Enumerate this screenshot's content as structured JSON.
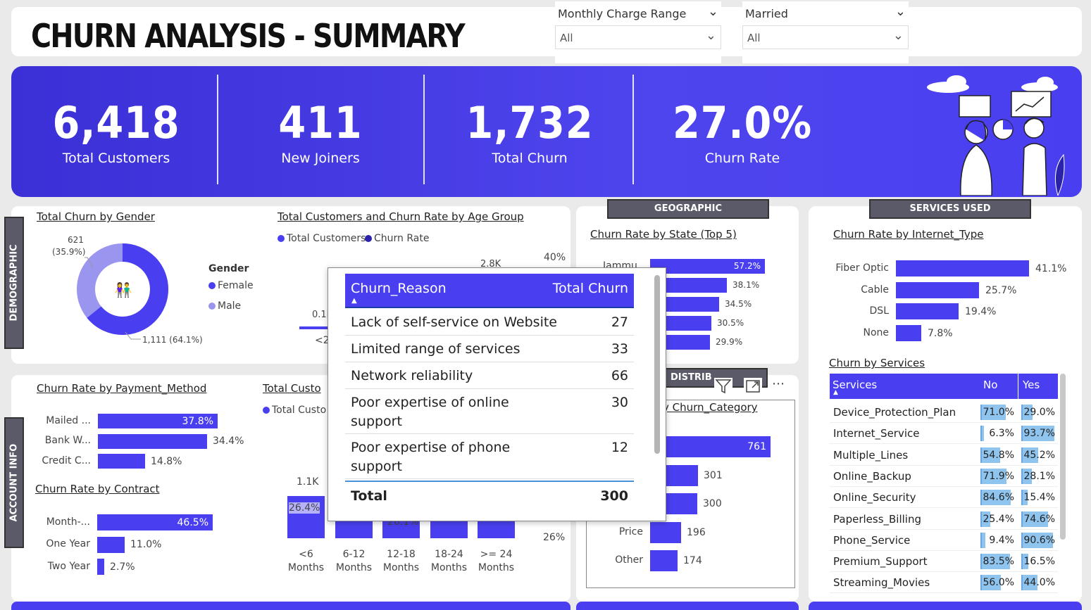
{
  "title": "CHURN ANALYSIS - SUMMARY",
  "filters": [
    {
      "label": "Monthly Charge Range",
      "value": "All"
    },
    {
      "label": "Married",
      "value": "All"
    }
  ],
  "kpis": [
    {
      "value": "6,418",
      "label": "Total Customers"
    },
    {
      "value": "411",
      "label": "New Joiners"
    },
    {
      "value": "1,732",
      "label": "Total Churn"
    },
    {
      "value": "27.0%",
      "label": "Churn Rate"
    }
  ],
  "section_tags": {
    "demographic": "DEMOGRAPHIC",
    "account_info": "ACCOUNT INFO",
    "geographic": "GEOGRAPHIC",
    "services_used": "SERVICES USED",
    "distribution": "DISTRIB"
  },
  "gender": {
    "title": "Total Churn by Gender",
    "legend_title": "Gender",
    "legend": [
      "Female",
      "Male"
    ],
    "male_label": "621",
    "male_pct": "(35.9%)",
    "female_label": "1,111 (64.1%)",
    "female_share": 0.641,
    "colors": {
      "female": "#4a3ff0",
      "male": "#9a95ee"
    }
  },
  "age_group": {
    "title": "Total Customers and Churn Rate by Age Group",
    "legend": [
      "Total Customers",
      "Churn Rate"
    ],
    "visible_labels": {
      "y2_top": "40%",
      "total_top": "2.8K",
      "low": "0.1K",
      "cat_partial": "<20"
    }
  },
  "payment": {
    "title": "Churn Rate by Payment_Method",
    "items": [
      {
        "label": "Mailed ...",
        "value": 37.8,
        "text": "37.8%",
        "inside": true
      },
      {
        "label": "Bank W...",
        "value": 34.4,
        "text": "34.4%",
        "inside": false
      },
      {
        "label": "Credit C...",
        "value": 14.8,
        "text": "14.8%",
        "inside": false
      }
    ]
  },
  "contract": {
    "title": "Churn Rate by Contract",
    "items": [
      {
        "label": "Month-...",
        "value": 46.5,
        "text": "46.5%",
        "inside": true
      },
      {
        "label": "One Year",
        "value": 11.0,
        "text": "11.0%",
        "inside": false
      },
      {
        "label": "Two Year",
        "value": 2.7,
        "text": "2.7%",
        "inside": false
      }
    ]
  },
  "tenure": {
    "title": "Total Customers and Churn Rate by Tenure Group",
    "title_visible": "Total Custo",
    "legend_visible": "Total Custo",
    "categories": [
      "<6 Months",
      "6-12 Months",
      "12-18 Months",
      "18-24 Months",
      ">= 24 Months"
    ],
    "cat_line1": [
      "<6",
      "6-12",
      "12-18",
      "18-24",
      ">= 24"
    ],
    "cat_line2": [
      "Months",
      "Months",
      "Months",
      "Months",
      "Months"
    ],
    "labels": {
      "top": "1.1K",
      "rate1": "26.4%",
      "rate3": "26.1%",
      "right": "26%"
    }
  },
  "state": {
    "title": "Churn Rate by State (Top 5)",
    "first_label": "Jammu",
    "items": [
      {
        "value": 57.2,
        "text": "57.2%",
        "inside": true
      },
      {
        "value": 38.1,
        "text": "38.1%",
        "inside": false
      },
      {
        "value": 34.5,
        "text": "34.5%",
        "inside": false
      },
      {
        "value": 30.5,
        "text": "30.5%",
        "inside": false
      },
      {
        "value": 29.9,
        "text": "29.9%",
        "inside": false
      }
    ]
  },
  "churn_category": {
    "title_visible": "y Churn_Category",
    "items": [
      {
        "label": "",
        "value": 761,
        "text": "761",
        "inside": true
      },
      {
        "label": "",
        "value": 301,
        "text": "301",
        "inside": false
      },
      {
        "label": "",
        "value": 300,
        "text": "300",
        "inside": false
      },
      {
        "label": "Price",
        "value": 196,
        "text": "196",
        "inside": false
      },
      {
        "label": "Other",
        "value": 174,
        "text": "174",
        "inside": false
      }
    ]
  },
  "internet": {
    "title": "Churn Rate by Internet_Type",
    "items": [
      {
        "label": "Fiber Optic",
        "value": 41.1,
        "text": "41.1%"
      },
      {
        "label": "Cable",
        "value": 25.7,
        "text": "25.7%"
      },
      {
        "label": "DSL",
        "value": 19.4,
        "text": "19.4%"
      },
      {
        "label": "None",
        "value": 7.8,
        "text": "7.8%"
      }
    ]
  },
  "services": {
    "title": "Churn by Services",
    "headers": [
      "Services",
      "No",
      "Yes"
    ],
    "rows": [
      {
        "name": "Device_Protection_Plan",
        "no": 71.0,
        "no_t": "71.0%",
        "yes": 29.0,
        "yes_t": "29.0%"
      },
      {
        "name": "Internet_Service",
        "no": 6.3,
        "no_t": "6.3%",
        "yes": 93.7,
        "yes_t": "93.7%"
      },
      {
        "name": "Multiple_Lines",
        "no": 54.8,
        "no_t": "54.8%",
        "yes": 45.2,
        "yes_t": "45.2%"
      },
      {
        "name": "Online_Backup",
        "no": 71.9,
        "no_t": "71.9%",
        "yes": 28.1,
        "yes_t": "28.1%"
      },
      {
        "name": "Online_Security",
        "no": 84.6,
        "no_t": "84.6%",
        "yes": 15.4,
        "yes_t": "15.4%"
      },
      {
        "name": "Paperless_Billing",
        "no": 25.4,
        "no_t": "25.4%",
        "yes": 74.6,
        "yes_t": "74.6%"
      },
      {
        "name": "Phone_Service",
        "no": 9.4,
        "no_t": "9.4%",
        "yes": 90.6,
        "yes_t": "90.6%"
      },
      {
        "name": "Premium_Support",
        "no": 83.5,
        "no_t": "83.5%",
        "yes": 16.5,
        "yes_t": "16.5%"
      },
      {
        "name": "Streaming_Movies",
        "no": 56.0,
        "no_t": "56.0%",
        "yes": 44.0,
        "yes_t": "44.0%"
      }
    ]
  },
  "tooltip": {
    "headers": [
      "Churn_Reason",
      "Total Churn"
    ],
    "rows": [
      {
        "reason": "Lack of self-service on Website",
        "value": "27"
      },
      {
        "reason": "Limited range of services",
        "value": "33"
      },
      {
        "reason": "Network reliability",
        "value": "66"
      },
      {
        "reason": "Poor expertise of online support",
        "value": "30"
      },
      {
        "reason": "Poor expertise of phone support",
        "value": "12"
      }
    ],
    "total_label": "Total",
    "total_value": "300"
  },
  "icons": [
    "chevron-down-icon",
    "filter-icon",
    "focus-mode-icon",
    "more-options-icon",
    "gender-icon",
    "sort-asc-icon"
  ],
  "colors": {
    "accent": "#4a3ff0",
    "band": "#3b2fd6",
    "tag": "#5a5a68",
    "cond_fill": "#8fc4ee"
  }
}
